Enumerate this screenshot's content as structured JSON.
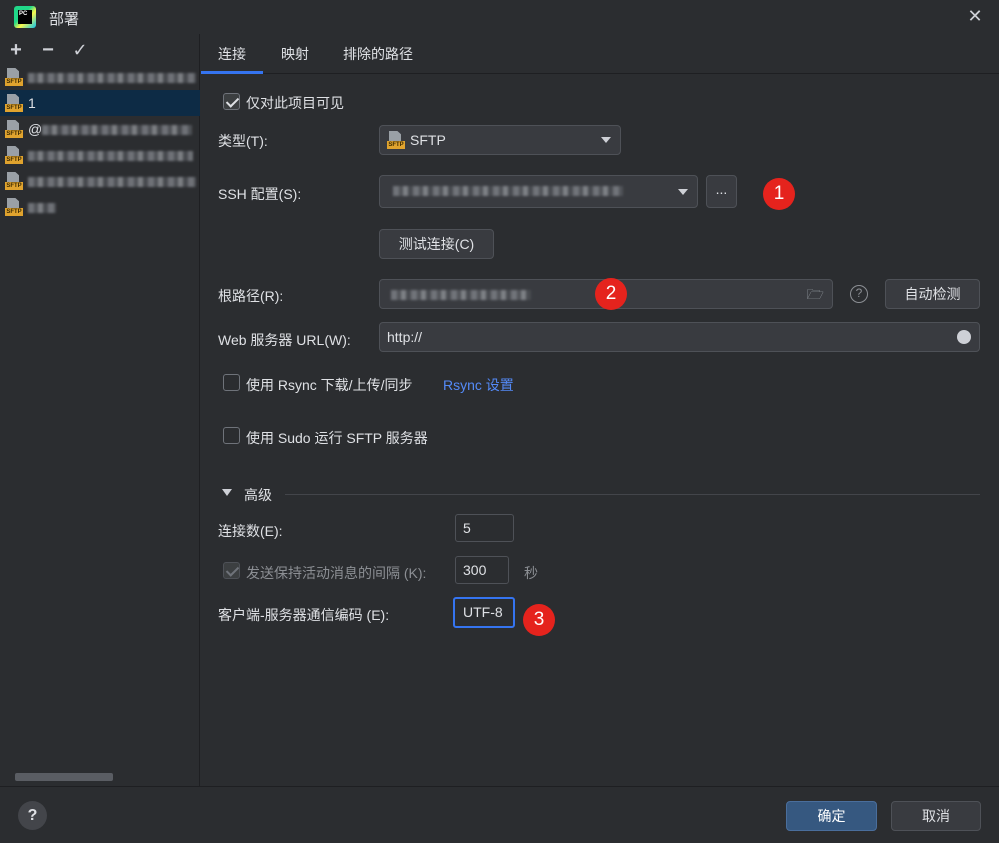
{
  "window": {
    "title": "部署",
    "app_icon_text": "PC"
  },
  "sidebar": {
    "toolbar": {
      "add": "+",
      "remove": "−",
      "check": "✓"
    },
    "items": [
      {
        "label": "",
        "blurred": true
      },
      {
        "label": "1",
        "blurred": false,
        "selected": true
      },
      {
        "label": "@",
        "blurred": true
      },
      {
        "label": "",
        "blurred": true
      },
      {
        "label": "",
        "blurred": true
      },
      {
        "label": "",
        "blurred": true
      }
    ],
    "icon_tag": "SFTP"
  },
  "tabs": [
    {
      "label": "连接",
      "active": true
    },
    {
      "label": "映射",
      "active": false
    },
    {
      "label": "排除的路径",
      "active": false
    }
  ],
  "connection": {
    "visible_only_label": "仅对此项目可见",
    "visible_only_checked": true,
    "type_label": "类型(T):",
    "type_value": "SFTP",
    "ssh_label": "SSH 配置(S):",
    "ssh_more_button": "...",
    "test_button": "测试连接(C)",
    "root_label": "根路径(R):",
    "root_help": "?",
    "auto_detect_button": "自动检测",
    "web_url_label": "Web 服务器 URL(W):",
    "web_url_value": "http://",
    "rsync_label": "使用 Rsync 下载/上传/同步",
    "rsync_link": "Rsync 设置",
    "sudo_label": "使用 Sudo 运行 SFTP 服务器"
  },
  "advanced": {
    "section_label": "高级",
    "connections_label": "连接数(E):",
    "connections_value": "5",
    "keepalive_label": "发送保持活动消息的间隔 (K):",
    "keepalive_value": "300",
    "keepalive_unit": "秒",
    "encoding_label": "客户端-服务器通信编码 (E):",
    "encoding_value": "UTF-8"
  },
  "annotations": [
    "1",
    "2",
    "3"
  ],
  "footer": {
    "help": "?",
    "ok_button": "确定",
    "cancel_button": "取消"
  },
  "colors": {
    "accent": "#3574f0",
    "annotation_red": "#e5231d",
    "selection": "#0d2b45"
  }
}
